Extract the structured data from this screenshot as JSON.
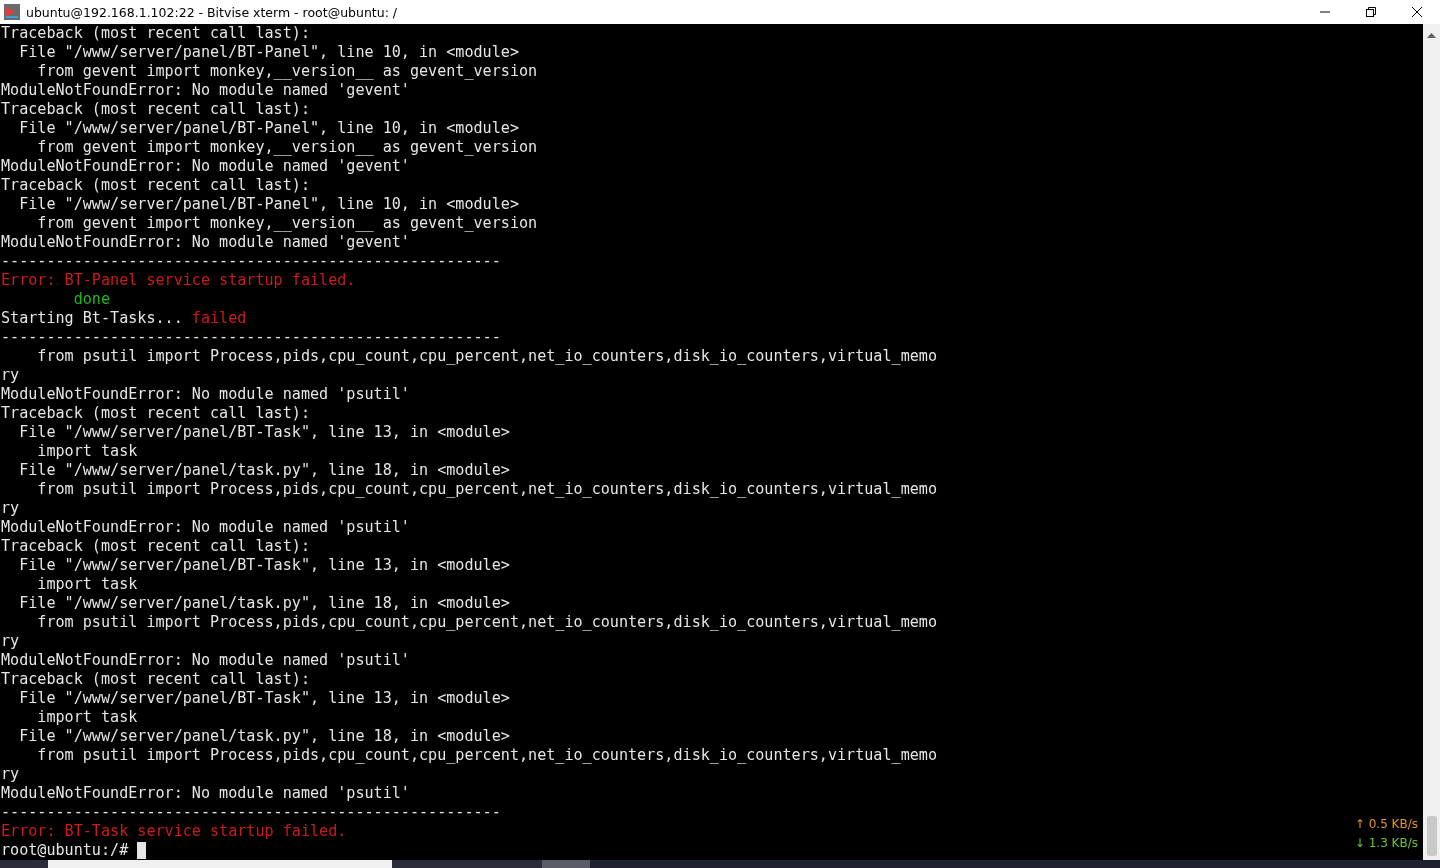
{
  "window": {
    "title": "ubuntu@192.168.1.102:22 - Bitvise xterm - root@ubuntu: /"
  },
  "terminal": {
    "lines": [
      [
        {
          "text": "Traceback (most recent call last):",
          "kind": "normal"
        }
      ],
      [
        {
          "text": "  File \"/www/server/panel/BT-Panel\", line 10, in <module>",
          "kind": "normal"
        }
      ],
      [
        {
          "text": "    from gevent import monkey,__version__ as gevent_version",
          "kind": "normal"
        }
      ],
      [
        {
          "text": "ModuleNotFoundError: No module named 'gevent'",
          "kind": "normal"
        }
      ],
      [
        {
          "text": "Traceback (most recent call last):",
          "kind": "normal"
        }
      ],
      [
        {
          "text": "  File \"/www/server/panel/BT-Panel\", line 10, in <module>",
          "kind": "normal"
        }
      ],
      [
        {
          "text": "    from gevent import monkey,__version__ as gevent_version",
          "kind": "normal"
        }
      ],
      [
        {
          "text": "ModuleNotFoundError: No module named 'gevent'",
          "kind": "normal"
        }
      ],
      [
        {
          "text": "Traceback (most recent call last):",
          "kind": "normal"
        }
      ],
      [
        {
          "text": "  File \"/www/server/panel/BT-Panel\", line 10, in <module>",
          "kind": "normal"
        }
      ],
      [
        {
          "text": "    from gevent import monkey,__version__ as gevent_version",
          "kind": "normal"
        }
      ],
      [
        {
          "text": "ModuleNotFoundError: No module named 'gevent'",
          "kind": "normal"
        }
      ],
      [
        {
          "text": "-------------------------------------------------------",
          "kind": "normal"
        }
      ],
      [
        {
          "text": "Error: BT-Panel service startup failed.",
          "kind": "error"
        }
      ],
      [
        {
          "text": "        done",
          "kind": "success"
        }
      ],
      [
        {
          "text": "Starting Bt-Tasks... ",
          "kind": "normal"
        },
        {
          "text": "failed",
          "kind": "error"
        }
      ],
      [
        {
          "text": "-------------------------------------------------------",
          "kind": "normal"
        }
      ],
      [
        {
          "text": "    from psutil import Process,pids,cpu_count,cpu_percent,net_io_counters,disk_io_counters,virtual_memo",
          "kind": "normal"
        }
      ],
      [
        {
          "text": "ry",
          "kind": "normal"
        }
      ],
      [
        {
          "text": "ModuleNotFoundError: No module named 'psutil'",
          "kind": "normal"
        }
      ],
      [
        {
          "text": "Traceback (most recent call last):",
          "kind": "normal"
        }
      ],
      [
        {
          "text": "  File \"/www/server/panel/BT-Task\", line 13, in <module>",
          "kind": "normal"
        }
      ],
      [
        {
          "text": "    import task",
          "kind": "normal"
        }
      ],
      [
        {
          "text": "  File \"/www/server/panel/task.py\", line 18, in <module>",
          "kind": "normal"
        }
      ],
      [
        {
          "text": "    from psutil import Process,pids,cpu_count,cpu_percent,net_io_counters,disk_io_counters,virtual_memo",
          "kind": "normal"
        }
      ],
      [
        {
          "text": "ry",
          "kind": "normal"
        }
      ],
      [
        {
          "text": "ModuleNotFoundError: No module named 'psutil'",
          "kind": "normal"
        }
      ],
      [
        {
          "text": "Traceback (most recent call last):",
          "kind": "normal"
        }
      ],
      [
        {
          "text": "  File \"/www/server/panel/BT-Task\", line 13, in <module>",
          "kind": "normal"
        }
      ],
      [
        {
          "text": "    import task",
          "kind": "normal"
        }
      ],
      [
        {
          "text": "  File \"/www/server/panel/task.py\", line 18, in <module>",
          "kind": "normal"
        }
      ],
      [
        {
          "text": "    from psutil import Process,pids,cpu_count,cpu_percent,net_io_counters,disk_io_counters,virtual_memo",
          "kind": "normal"
        }
      ],
      [
        {
          "text": "ry",
          "kind": "normal"
        }
      ],
      [
        {
          "text": "ModuleNotFoundError: No module named 'psutil'",
          "kind": "normal"
        }
      ],
      [
        {
          "text": "Traceback (most recent call last):",
          "kind": "normal"
        }
      ],
      [
        {
          "text": "  File \"/www/server/panel/BT-Task\", line 13, in <module>",
          "kind": "normal"
        }
      ],
      [
        {
          "text": "    import task",
          "kind": "normal"
        }
      ],
      [
        {
          "text": "  File \"/www/server/panel/task.py\", line 18, in <module>",
          "kind": "normal"
        }
      ],
      [
        {
          "text": "    from psutil import Process,pids,cpu_count,cpu_percent,net_io_counters,disk_io_counters,virtual_memo",
          "kind": "normal"
        }
      ],
      [
        {
          "text": "ry",
          "kind": "normal"
        }
      ],
      [
        {
          "text": "ModuleNotFoundError: No module named 'psutil'",
          "kind": "normal"
        }
      ],
      [
        {
          "text": "-------------------------------------------------------",
          "kind": "normal"
        }
      ],
      [
        {
          "text": "Error: BT-Task service startup failed.",
          "kind": "error"
        }
      ],
      [
        {
          "text": "root@ubuntu:/# ",
          "kind": "normal"
        }
      ]
    ],
    "prompt_cursor": true
  },
  "net_speed": {
    "upload": "↑ 0.5 KB/s",
    "download": "↓ 1.3 KB/s"
  }
}
